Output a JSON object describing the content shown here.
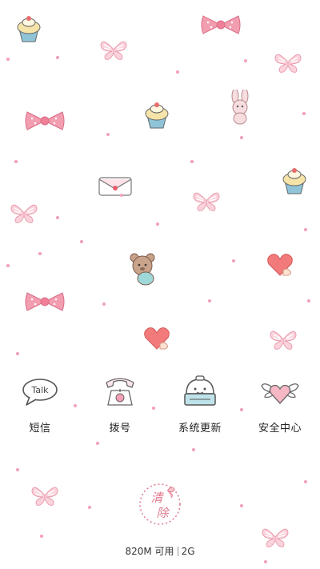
{
  "apps": [
    {
      "name": "sms",
      "label": "短信",
      "icon": "talk-bubble-icon",
      "icon_text": "Talk"
    },
    {
      "name": "dialer",
      "label": "拨号",
      "icon": "telephone-icon"
    },
    {
      "name": "system-update",
      "label": "系统更新",
      "icon": "radio-icon"
    },
    {
      "name": "security-center",
      "label": "安全中心",
      "icon": "winged-heart-icon"
    }
  ],
  "cleaner": {
    "icon": "clean-memory-icon",
    "label_top": "清",
    "label_bottom": "除"
  },
  "memory": {
    "available": "820M 可用",
    "total": "2G"
  },
  "colors": {
    "accent_pink": "#f4a0b6",
    "heart_red": "#f27a7a",
    "bow_pink": "#f29db0"
  }
}
